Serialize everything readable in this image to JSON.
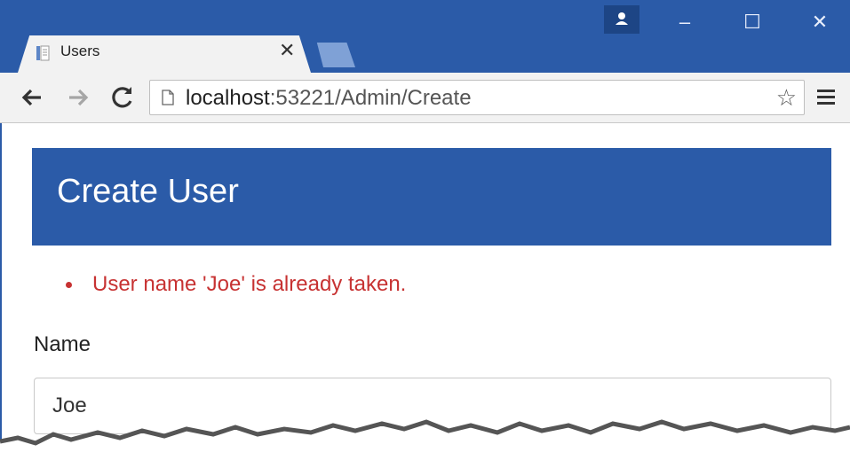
{
  "browser": {
    "tab": {
      "title": "Users",
      "close_glyph": "✕"
    },
    "window_controls": {
      "minimize": "–",
      "maximize": "☐",
      "close": "✕"
    },
    "address": {
      "host": "localhost",
      "path": ":53221/Admin/Create"
    }
  },
  "page": {
    "heading": "Create User",
    "errors": [
      "User name 'Joe' is already taken."
    ],
    "form": {
      "name_label": "Name",
      "name_value": "Joe"
    }
  },
  "colors": {
    "brand_blue": "#2b5ba8",
    "error_red": "#c73232"
  }
}
